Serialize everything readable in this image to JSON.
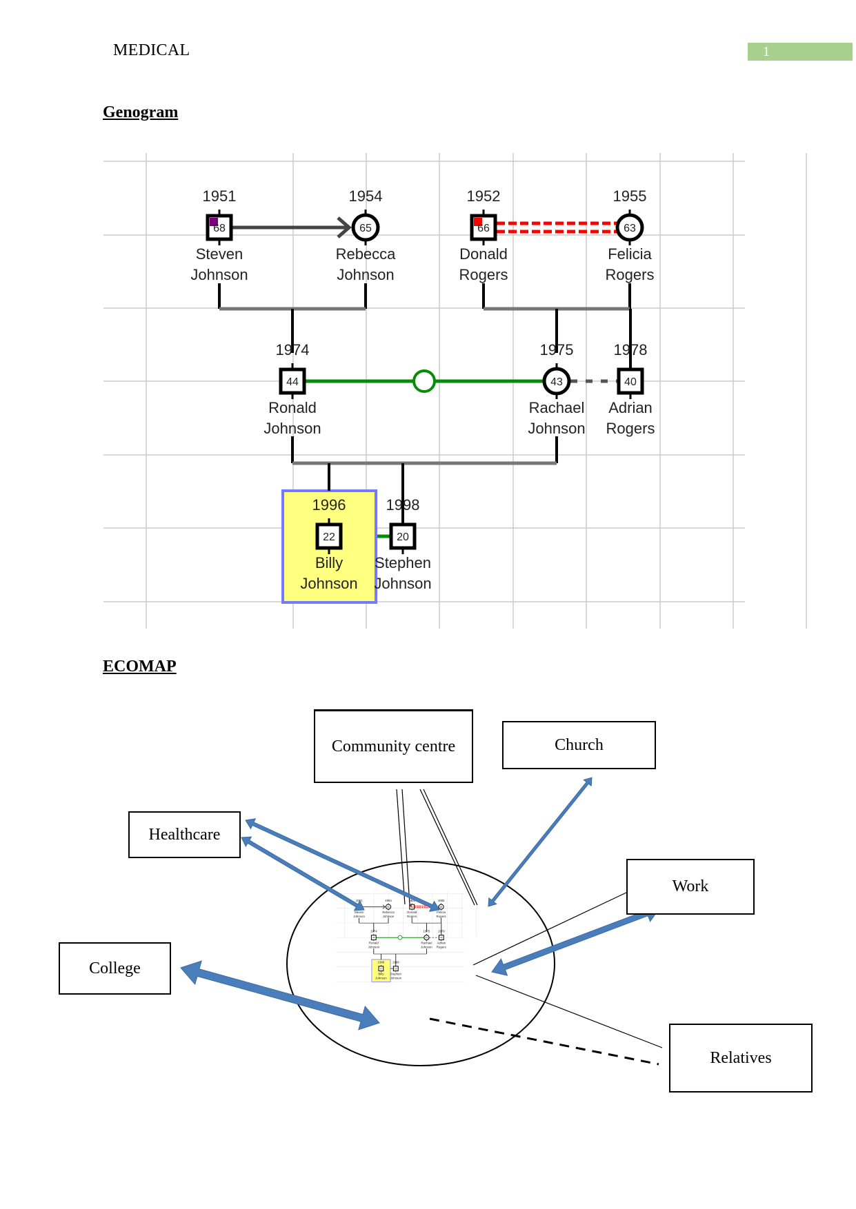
{
  "header": {
    "title": "MEDICAL",
    "page_number": "1"
  },
  "sections": {
    "genogram_title": "Genogram",
    "ecomap_title": "ECOMAP"
  },
  "colors": {
    "page_badge": "#a8d08d",
    "relationship_green": "#078c07",
    "conflict_red": "#ff0000",
    "arrow_blue": "#4a7ebb",
    "focus_fill": "#ffff80",
    "focus_border": "#7777ff"
  },
  "genogram": {
    "people": [
      {
        "id": "steven",
        "year": "1951",
        "age": "68",
        "first": "Steven",
        "last": "Johnson",
        "sex": "male",
        "marker": "purple"
      },
      {
        "id": "rebecca",
        "year": "1954",
        "age": "65",
        "first": "Rebecca",
        "last": "Johnson",
        "sex": "female"
      },
      {
        "id": "donald",
        "year": "1952",
        "age": "66",
        "first": "Donald",
        "last": "Rogers",
        "sex": "male",
        "marker": "red"
      },
      {
        "id": "felicia",
        "year": "1955",
        "age": "63",
        "first": "Felicia",
        "last": "Rogers",
        "sex": "female"
      },
      {
        "id": "ronald",
        "year": "1974",
        "age": "44",
        "first": "Ronald",
        "last": "Johnson",
        "sex": "male"
      },
      {
        "id": "rachael",
        "year": "1975",
        "age": "43",
        "first": "Rachael",
        "last": "Johnson",
        "sex": "female"
      },
      {
        "id": "adrian",
        "year": "1978",
        "age": "40",
        "first": "Adrian",
        "last": "Rogers",
        "sex": "male"
      },
      {
        "id": "billy",
        "year": "1996",
        "age": "22",
        "first": "Billy",
        "last": "Johnson",
        "sex": "male",
        "focus": true
      },
      {
        "id": "stephen",
        "year": "1998",
        "age": "20",
        "first": "Stephen",
        "last": "Johnson",
        "sex": "male"
      }
    ],
    "relationships": [
      {
        "from": "steven",
        "to": "rebecca",
        "type": "directed-arrow"
      },
      {
        "from": "donald",
        "to": "felicia",
        "type": "hostile-dashed-red"
      },
      {
        "from": "ronald",
        "to": "rachael",
        "type": "close-green"
      },
      {
        "from": "rachael",
        "to": "adrian",
        "type": "distant-dashed"
      },
      {
        "from": "billy",
        "to": "stephen",
        "type": "close-green"
      }
    ]
  },
  "ecomap": {
    "systems": [
      {
        "id": "community",
        "label": "Community centre"
      },
      {
        "id": "church",
        "label": "Church"
      },
      {
        "id": "healthcare",
        "label": "Healthcare"
      },
      {
        "id": "work",
        "label": "Work"
      },
      {
        "id": "college",
        "label": "College"
      },
      {
        "id": "relatives",
        "label": "Relatives"
      }
    ]
  }
}
